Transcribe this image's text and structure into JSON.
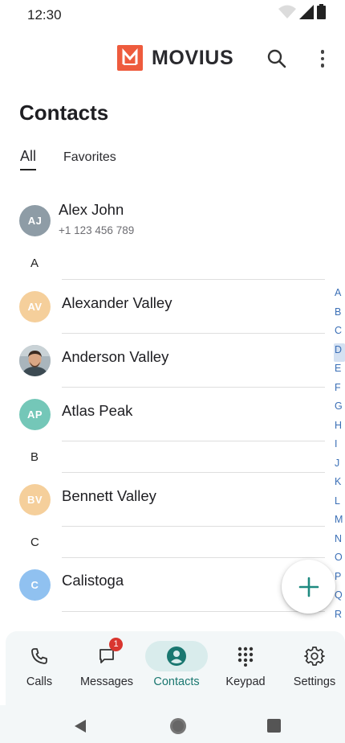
{
  "status": {
    "time": "12:30"
  },
  "app": {
    "brand": "MOVIUS",
    "brand_color": "#ee5b3d"
  },
  "page": {
    "title": "Contacts"
  },
  "tabs": [
    {
      "label": "All",
      "active": true
    },
    {
      "label": "Favorites",
      "active": false
    }
  ],
  "contacts": {
    "me": {
      "initials": "AJ",
      "name": "Alex John",
      "phone": "+1 123 456 789",
      "color": "#8e9ca6"
    },
    "sections": [
      {
        "letter": "A",
        "items": [
          {
            "initials": "AV",
            "name": "Alexander Valley",
            "color": "#f5cf9b"
          },
          {
            "initials": "",
            "name": "Anderson Valley",
            "photo": true
          },
          {
            "initials": "AP",
            "name": "Atlas Peak",
            "color": "#74c7b8"
          }
        ]
      },
      {
        "letter": "B",
        "items": [
          {
            "initials": "BV",
            "name": "Bennett Valley",
            "color": "#f5cf9b"
          }
        ]
      },
      {
        "letter": "C",
        "items": [
          {
            "initials": "C",
            "name": "Calistoga",
            "color": "#90c1f0"
          }
        ]
      }
    ]
  },
  "index_letters": [
    "A",
    "B",
    "C",
    "D",
    "E",
    "F",
    "G",
    "H",
    "I",
    "J",
    "K",
    "L",
    "M",
    "N",
    "O",
    "P",
    "Q",
    "R"
  ],
  "index_active": "D",
  "bottom_nav": {
    "calls": "Calls",
    "messages": "Messages",
    "messages_badge": "1",
    "contacts": "Contacts",
    "keypad": "Keypad",
    "settings": "Settings"
  },
  "colors": {
    "accent": "#1a7770",
    "fab_icon": "#1e8a80",
    "nav_active_bg": "#d9ecec"
  }
}
